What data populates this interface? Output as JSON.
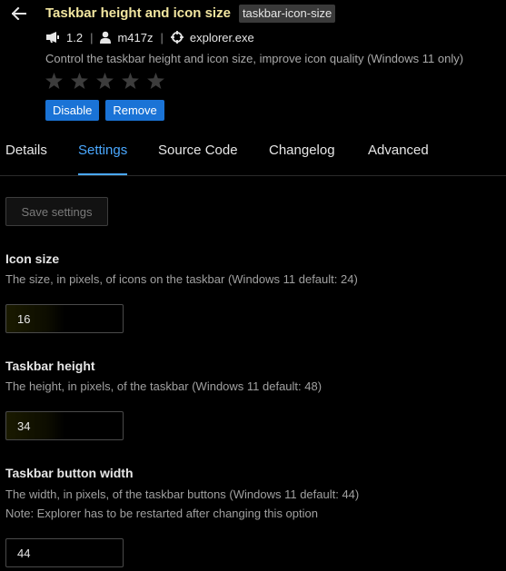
{
  "header": {
    "title": "Taskbar height and icon size",
    "id_badge": "taskbar-icon-size",
    "version": "1.2",
    "author": "m417z",
    "process": "explorer.exe",
    "description": "Control the taskbar height and icon size, improve icon quality (Windows 11 only)",
    "rating": {
      "value": 0,
      "max": 5
    },
    "disable_label": "Disable",
    "remove_label": "Remove",
    "icons": [
      "back-arrow-icon",
      "megaphone-icon",
      "person-icon",
      "crosshair-icon",
      "star-icon"
    ]
  },
  "tabs": [
    {
      "label": "Details",
      "active": false
    },
    {
      "label": "Settings",
      "active": true
    },
    {
      "label": "Source Code",
      "active": false
    },
    {
      "label": "Changelog",
      "active": false
    },
    {
      "label": "Advanced",
      "active": false
    }
  ],
  "settings": {
    "save_label": "Save settings",
    "items": [
      {
        "title": "Icon size",
        "description": "The size, in pixels, of icons on the taskbar (Windows 11 default: 24)",
        "value": "16"
      },
      {
        "title": "Taskbar height",
        "description": "The height, in pixels, of the taskbar (Windows 11 default: 48)",
        "value": "34"
      },
      {
        "title": "Taskbar button width",
        "description": "The width, in pixels, of the taskbar buttons (Windows 11 default: 44)",
        "note": "Note: Explorer has to be restarted after changing this option",
        "value": "44"
      }
    ]
  },
  "colors": {
    "accent": "#4aa8ff",
    "primary_button": "#1a73d6",
    "title": "#f2e6a0",
    "background": "#000000"
  }
}
